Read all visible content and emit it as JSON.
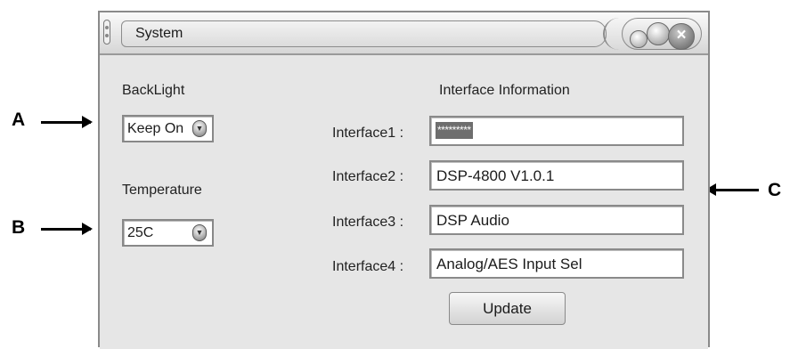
{
  "window": {
    "title": "System"
  },
  "titlebar_icons": [
    "grip-icon",
    "minimize-icon",
    "maximize-icon",
    "close-icon"
  ],
  "close_glyph": "×",
  "backlight": {
    "label": "BackLight",
    "value": "Keep On"
  },
  "temperature": {
    "label": "Temperature",
    "value": "25C"
  },
  "interface_info": {
    "heading": "Interface Information",
    "items": [
      {
        "label": "Interface1 :",
        "value": "*********"
      },
      {
        "label": "Interface2 :",
        "value": "DSP-4800  V1.0.1"
      },
      {
        "label": "Interface3 :",
        "value": "DSP Audio"
      },
      {
        "label": "Interface4 :",
        "value": "Analog/AES Input Sel"
      }
    ]
  },
  "update_button": "Update",
  "callouts": {
    "a": "A",
    "b": "B",
    "c": "C"
  }
}
